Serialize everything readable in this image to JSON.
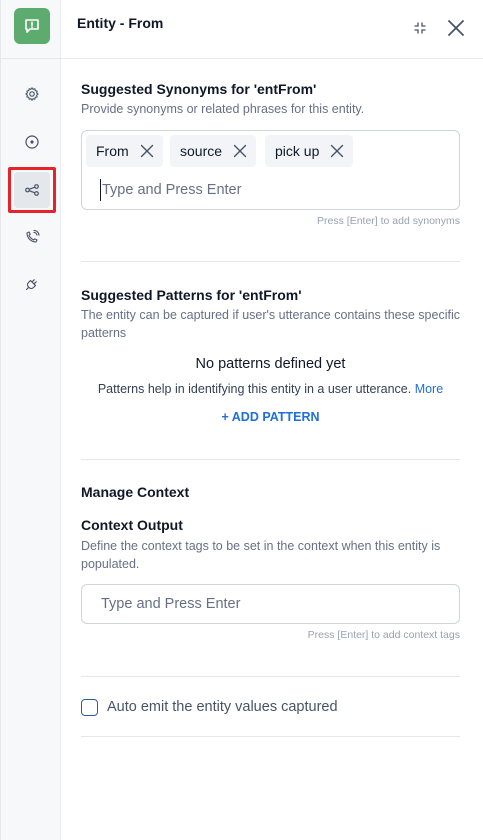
{
  "header": {
    "title": "Entity - From",
    "collapse_icon": "collapse-arrows-icon",
    "close_icon": "close-icon"
  },
  "sidebar": {
    "logo_icon": "chat-alert-icon",
    "logo_color": "#5dab6e",
    "active_index": 2,
    "items": [
      {
        "icon": "gear-icon"
      },
      {
        "icon": "target-icon"
      },
      {
        "icon": "share-nodes-icon"
      },
      {
        "icon": "phone-refresh-icon"
      },
      {
        "icon": "plug-icon"
      }
    ]
  },
  "synonyms": {
    "title": "Suggested Synonyms for 'entFrom'",
    "description": "Provide synonyms or related phrases for this entity.",
    "chips": [
      "From",
      "source",
      "pick up"
    ],
    "input_placeholder": "Type and Press Enter",
    "hint": "Press [Enter] to add synonyms"
  },
  "patterns": {
    "title": "Suggested Patterns for 'entFrom'",
    "description": "The entity can be captured if user's utterance contains these specific patterns",
    "empty_title": "No patterns defined yet",
    "empty_text": "Patterns help in identifying this entity in a user utterance.",
    "more_link": "More",
    "add_button": "+ ADD PATTERN"
  },
  "context": {
    "title": "Manage Context",
    "output_title": "Context Output",
    "output_description": "Define the context tags to be set in the context when this entity is populated.",
    "input_placeholder": "Type and Press Enter",
    "hint": "Press [Enter] to add context tags"
  },
  "auto_emit": {
    "label": "Auto emit the entity values captured",
    "checked": false
  },
  "colors": {
    "accent": "#1e6fd9",
    "highlight": "#e3252b"
  }
}
